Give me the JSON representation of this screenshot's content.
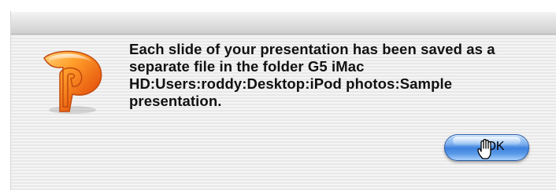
{
  "dialog": {
    "message": "Each slide of your presentation has been saved as a separate file in the folder G5 iMac HD:Users:roddy:Desktop:iPod photos:Sample presentation.",
    "app_icon": "powerpoint-icon",
    "ok_label": "OK",
    "cursor_icon": "hand-pointer-icon"
  },
  "colors": {
    "button_blue": "#3f82df",
    "icon_orange": "#f08a1c"
  }
}
